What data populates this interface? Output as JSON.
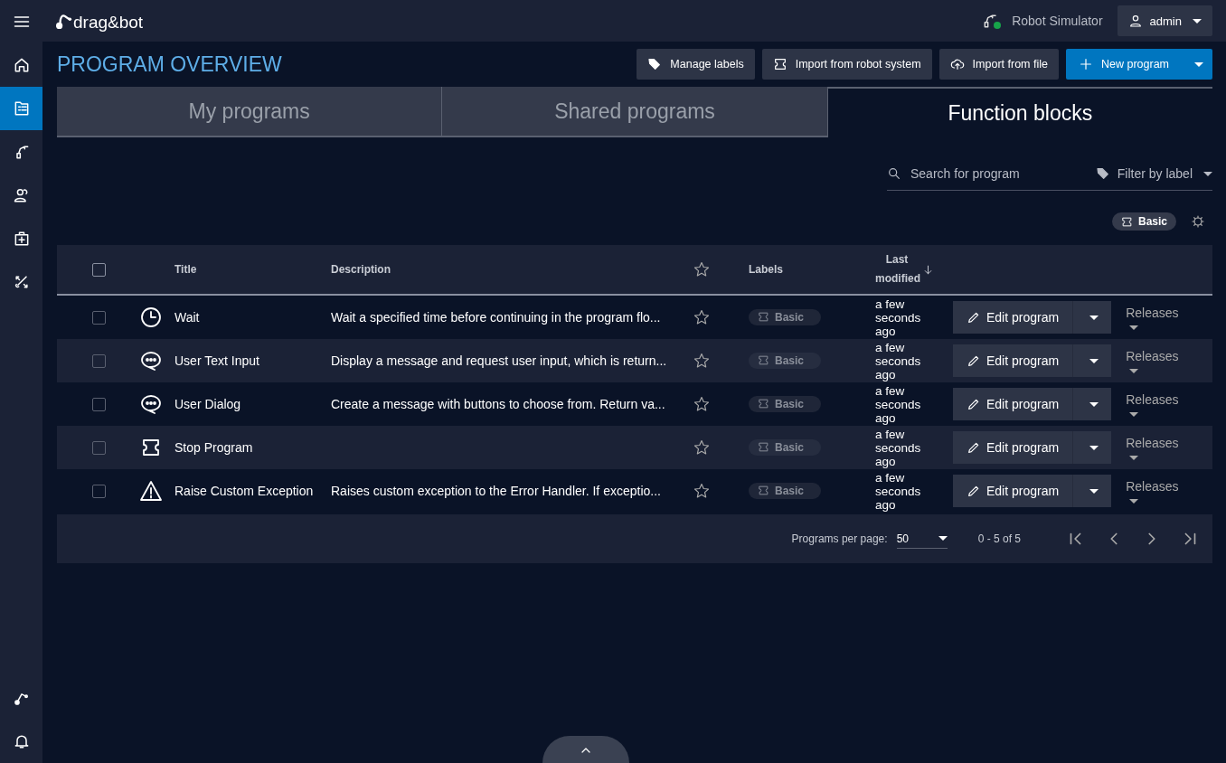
{
  "header": {
    "logo": "drag&bot",
    "robot": {
      "name": "Robot Simulator",
      "connected": true
    },
    "user": "admin"
  },
  "sidebar": {
    "items": [
      {
        "kind": "home",
        "selected": false
      },
      {
        "kind": "programs",
        "selected": true
      },
      {
        "kind": "robot",
        "selected": false
      },
      {
        "kind": "users",
        "selected": false
      },
      {
        "kind": "kit",
        "selected": false
      },
      {
        "kind": "tools",
        "selected": false
      }
    ],
    "bottom_items": [
      {
        "kind": "route",
        "selected": false
      },
      {
        "kind": "bell",
        "selected": false
      }
    ]
  },
  "page_title": "PROGRAM OVERVIEW",
  "toolbar": [
    {
      "kind": "labels",
      "label": "Manage labels"
    },
    {
      "kind": "import",
      "label": "Import from robot system"
    },
    {
      "kind": "upload",
      "label": "Import from file"
    },
    {
      "kind": "new",
      "label": "New program"
    }
  ],
  "tabs": [
    {
      "label": "My programs",
      "selected": false
    },
    {
      "label": "Shared programs",
      "selected": false
    },
    {
      "label": "Function blocks",
      "selected": true
    }
  ],
  "search": {
    "placeholder": "Search for program"
  },
  "filter": {
    "placeholder": "Filter by label"
  },
  "active_filters": [
    "Basic"
  ],
  "table": {
    "select_all_checked": false,
    "columns": [
      "Title",
      "Description",
      "Labels",
      "Last modified"
    ],
    "rows": [
      {
        "kind": "clock",
        "checked": false,
        "title": "Wait",
        "description": "Wait a specified time before continuing in the program flo...",
        "starred": false,
        "label": "Basic",
        "modified": "a few seconds ago",
        "edit": "Edit program",
        "releases": "Releases"
      },
      {
        "kind": "dialog",
        "checked": false,
        "title": "User Text Input",
        "description": "Display a message and request user input, which is return...",
        "starred": false,
        "label": "Basic",
        "modified": "a few seconds ago",
        "edit": "Edit program",
        "releases": "Releases"
      },
      {
        "kind": "dialog",
        "checked": false,
        "title": "User Dialog",
        "description": "Create a message with buttons to choose from. Return va...",
        "starred": false,
        "label": "Basic",
        "modified": "a few seconds ago",
        "edit": "Edit program",
        "releases": "Releases"
      },
      {
        "kind": "block",
        "checked": false,
        "title": "Stop Program",
        "starred": false,
        "label": "Basic",
        "modified": "a few seconds ago",
        "edit": "Edit program",
        "releases": "Releases"
      },
      {
        "kind": "warning",
        "checked": false,
        "title": "Raise Custom Exception",
        "description": "Raises custom exception to the Error Handler. If exceptio...",
        "starred": false,
        "label": "Basic",
        "modified": "a few seconds ago",
        "edit": "Edit program",
        "releases": "Releases"
      }
    ]
  },
  "pagination": {
    "per_page_label": "Programs per page:",
    "per_page": "50",
    "range": "0 - 5 of 5"
  }
}
